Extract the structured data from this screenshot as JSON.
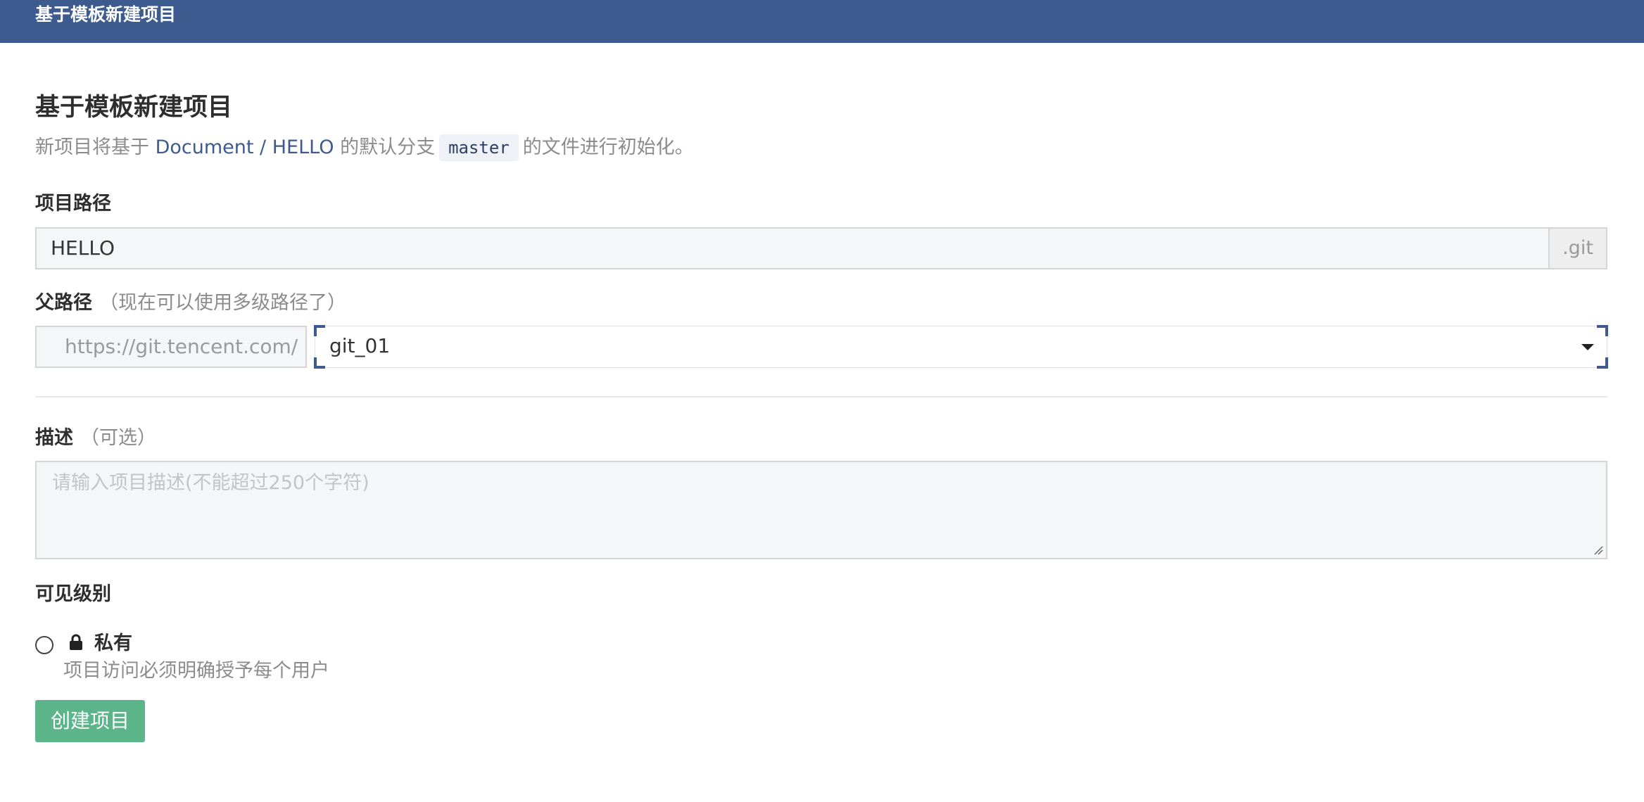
{
  "header": {
    "title": "基于模板新建项目"
  },
  "page": {
    "title": "基于模板新建项目",
    "description_prefix": "新项目将基于 ",
    "template_link": "Document / HELLO",
    "description_middle": " 的默认分支",
    "branch": "master",
    "description_suffix": "的文件进行初始化。"
  },
  "form": {
    "project_path": {
      "label": "项目路径",
      "value": "HELLO",
      "suffix": ".git"
    },
    "parent_path": {
      "label": "父路径",
      "hint": "（现在可以使用多级路径了）",
      "prefix": "https://git.tencent.com/",
      "selected": "git_01"
    },
    "description": {
      "label": "描述",
      "hint": "（可选）",
      "placeholder": "请输入项目描述(不能超过250个字符)"
    },
    "visibility": {
      "label": "可见级别",
      "options": [
        {
          "label": "私有",
          "icon": "lock-icon",
          "help": "项目访问必须明确授予每个用户",
          "checked": false
        }
      ]
    },
    "submit_label": "创建项目"
  },
  "colors": {
    "header_bg": "#3d5b8f",
    "link": "#3d5b8f",
    "primary_button": "#5cb48b"
  }
}
